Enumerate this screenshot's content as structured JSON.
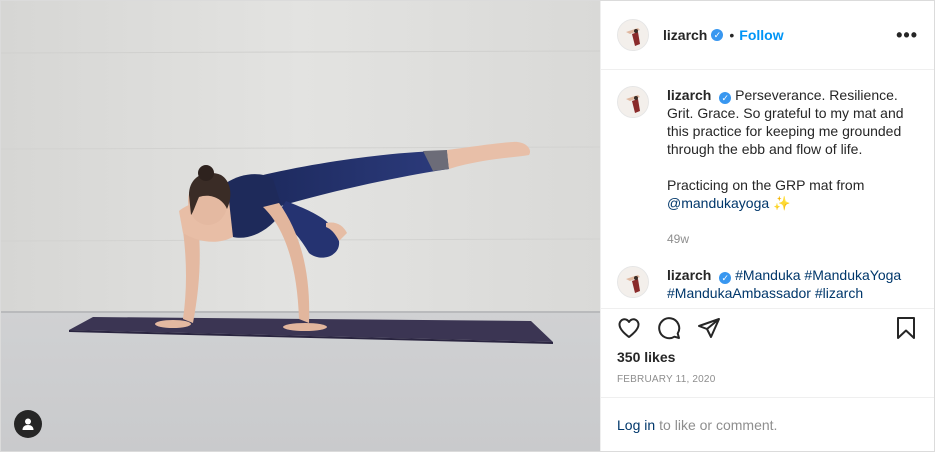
{
  "post": {
    "username": "lizarch",
    "follow_label": "Follow",
    "dot": "•",
    "more_label": "•••",
    "verified_mark": "✓"
  },
  "caption": {
    "username": "lizarch",
    "text": "Perseverance. Resilience. Grit. Grace. So grateful to my mat and this practice for keeping me grounded through the ebb and flow of life.\n\nPracticing on the GRP mat from ",
    "mention": "@mandukayoga",
    "emoji": "✨",
    "time": "49w"
  },
  "comment2": {
    "username": "lizarch",
    "hashtags": "#Manduka #MandukaYoga",
    "overflow_text": "#MandukaAmbassador #lizarch"
  },
  "engagement": {
    "likes": "350 likes",
    "date": "FEBRUARY 11, 2020"
  },
  "footer": {
    "login_label": "Log in",
    "rest_text": "to like or comment."
  },
  "icons": {
    "like": "heart-icon",
    "comment": "comment-icon",
    "share": "paper-plane-icon",
    "save": "bookmark-icon",
    "tag": "user-tag-icon",
    "verified": "verified-badge-icon",
    "more": "more-options-icon"
  },
  "colors": {
    "accent": "#0095f6",
    "verified": "#3897f0",
    "link": "#00376b",
    "muted": "#8e8e8e",
    "text": "#262626"
  }
}
